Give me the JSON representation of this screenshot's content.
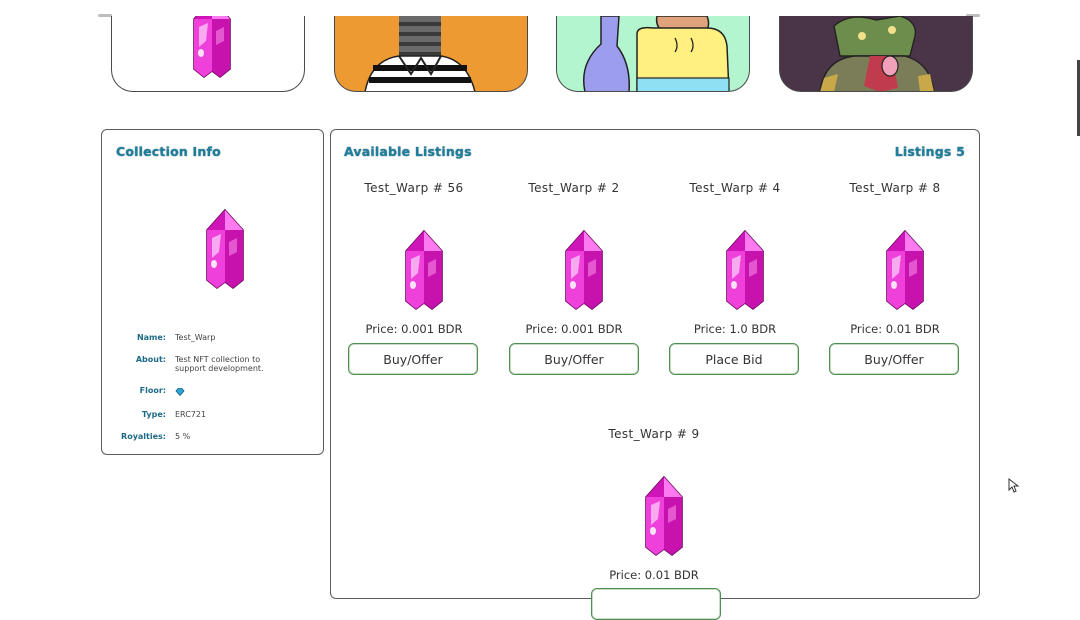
{
  "colors": {
    "accent": "#1e7f9c",
    "button_border": "#4f8f4f",
    "crystal": "#e81ccf",
    "banner_orange": "#ee9a32",
    "banner_mint": "#b3f5cf",
    "banner_purple": "#4a3548"
  },
  "banner": {
    "cards": [
      {
        "icon": "crystal-icon"
      },
      {
        "icon": "striped-shirt-character"
      },
      {
        "icon": "cartoon-character"
      },
      {
        "icon": "monster-character"
      }
    ]
  },
  "collection": {
    "title": "Collection Info",
    "fields": [
      {
        "label": "Name:",
        "value": "Test_Warp"
      },
      {
        "label": "About:",
        "value": "Test NFT collection to support development."
      },
      {
        "label": "Floor:",
        "value": "",
        "icon": "diamond-icon"
      },
      {
        "label": "Type:",
        "value": "ERC721"
      },
      {
        "label": "Royalties:",
        "value": "5 %"
      }
    ]
  },
  "listings": {
    "title": "Available Listings",
    "count_label": "Listings 5",
    "items": [
      {
        "name": "Test_Warp # 56",
        "price": "Price: 0.001 BDR",
        "action": "Buy/Offer"
      },
      {
        "name": "Test_Warp # 2",
        "price": "Price: 0.001 BDR",
        "action": "Buy/Offer"
      },
      {
        "name": "Test_Warp # 4",
        "price": "Price: 1.0 BDR",
        "action": "Place Bid"
      },
      {
        "name": "Test_Warp # 8",
        "price": "Price: 0.01 BDR",
        "action": "Buy/Offer"
      },
      {
        "name": "Test_Warp # 9",
        "price": "Price: 0.01 BDR",
        "action": ""
      }
    ]
  }
}
